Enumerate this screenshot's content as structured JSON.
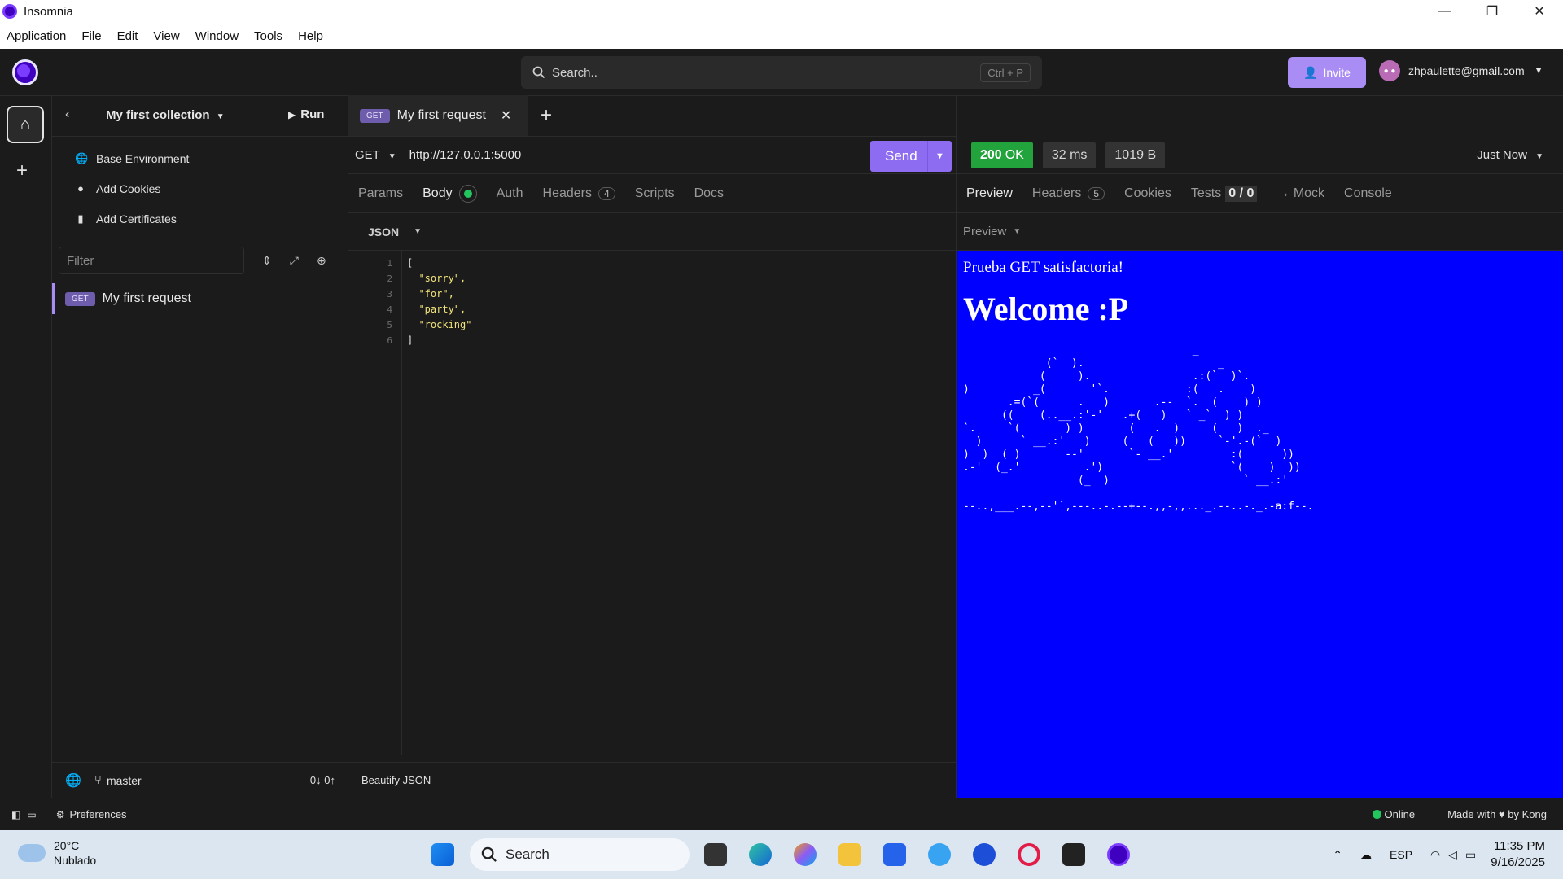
{
  "window": {
    "title": "Insomnia",
    "minimize": "—",
    "restore": "❐",
    "close": "✕"
  },
  "menu": [
    "Application",
    "File",
    "Edit",
    "View",
    "Window",
    "Tools",
    "Help"
  ],
  "header": {
    "search_placeholder": "Search..",
    "search_shortcut": "Ctrl + P",
    "invite_label": "Invite",
    "user_email": "zhpaulette@gmail.com"
  },
  "sidebar": {
    "collection_name": "My first collection",
    "run_label": "Run",
    "links": [
      {
        "label": "Base Environment",
        "icon": "globe-icon"
      },
      {
        "label": "Add Cookies",
        "icon": "cookie-icon"
      },
      {
        "label": "Add Certificates",
        "icon": "file-icon"
      }
    ],
    "filter_placeholder": "Filter",
    "requests": [
      {
        "method": "GET",
        "name": "My first request"
      }
    ],
    "branch": "master",
    "sync_counts": "0↓ 0↑"
  },
  "request": {
    "tab_method": "GET",
    "tab_name": "My first request",
    "method": "GET",
    "url": "http://127.0.0.1:5000",
    "send_label": "Send",
    "tabs": {
      "params": "Params",
      "body": "Body",
      "auth": "Auth",
      "headers": "Headers",
      "headers_count": "4",
      "scripts": "Scripts",
      "docs": "Docs"
    },
    "body_mode": "JSON",
    "code_lines": [
      {
        "n": "1",
        "text": "["
      },
      {
        "n": "2",
        "text": "  \"sorry\","
      },
      {
        "n": "3",
        "text": "  \"for\","
      },
      {
        "n": "4",
        "text": "  \"party\","
      },
      {
        "n": "5",
        "text": "  \"rocking\""
      },
      {
        "n": "6",
        "text": "]"
      }
    ],
    "beautify_label": "Beautify JSON"
  },
  "response": {
    "status": "200",
    "status_text": "OK",
    "time": "32 ms",
    "size": "1019 B",
    "history": "Just Now",
    "tabs": {
      "preview": "Preview",
      "headers": "Headers",
      "headers_count": "5",
      "cookies": "Cookies",
      "tests": "Tests",
      "tests_count": "0 / 0",
      "mock": "→ Mock",
      "console": "Console"
    },
    "preview_mode": "Preview",
    "preview_bg": "#0000ff",
    "preview_paragraph": "Prueba GET satisfactoria!",
    "preview_heading": "Welcome :P",
    "ascii_art": "                                    _\n             (`  ).                     _\n            (     ).                .:(`  )`.\n)          _(       '`.            :(   .    )\n       .=(`(      .   )       .--  `.  (    ) )\n      ((    (..__.:'-'   .+(   )   ` _`  ) )\n`.     `(       ) )       (   .  )     (   )  ._\n  )      ` __.:'   )     (   (   ))     `-'.-(`  )\n)  )  ( )       --'       `- __.'         :(      ))\n.-'  (_.'          .')                    `(    )  ))\n                  (_  )                     ` __.:'\n\n--..,___.--,--'`,---..-.--+--.,,-,,..._.--..-._.-a:f--."
  },
  "statusbar": {
    "preferences": "Preferences",
    "online": "Online",
    "made_with": "Made with ♥ by Kong"
  },
  "taskbar": {
    "temperature": "20°C",
    "weather": "Nublado",
    "search": "Search",
    "language": "ESP",
    "time": "11:35 PM",
    "date": "9/16/2025"
  }
}
